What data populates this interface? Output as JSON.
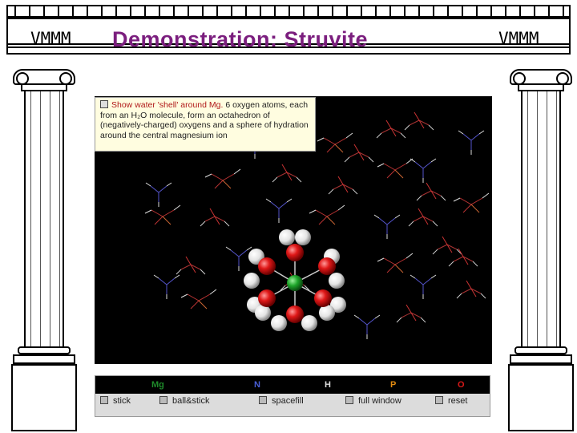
{
  "header": {
    "logo_left": "VMMM",
    "logo_right": "VMMM",
    "title": "Demonstration: Struvite"
  },
  "tooltip": {
    "lead": "Show water 'shell' around Mg.",
    "body": " 6 oxygen atoms, each from an H₂O molecule, form an octahedron of (negatively-charged) oxygens and a sphere of hydration around the central magnesium ion"
  },
  "legend": {
    "items": [
      {
        "label": "Mg",
        "color": "#1e8a2a"
      },
      {
        "label": "N",
        "color": "#4a5fd8"
      },
      {
        "label": "H",
        "color": "#dddddd"
      },
      {
        "label": "P",
        "color": "#e08a10"
      },
      {
        "label": "O",
        "color": "#d81818"
      }
    ]
  },
  "options": [
    {
      "label": "stick"
    },
    {
      "label": "ball&stick"
    },
    {
      "label": "spacefill"
    },
    {
      "label": "full window"
    },
    {
      "label": "reset"
    }
  ],
  "colors": {
    "title": "#7b1e7e",
    "viewer_bg": "#000000",
    "tooltip_bg": "#fffde0",
    "controls_bg": "#dcdcdc"
  }
}
